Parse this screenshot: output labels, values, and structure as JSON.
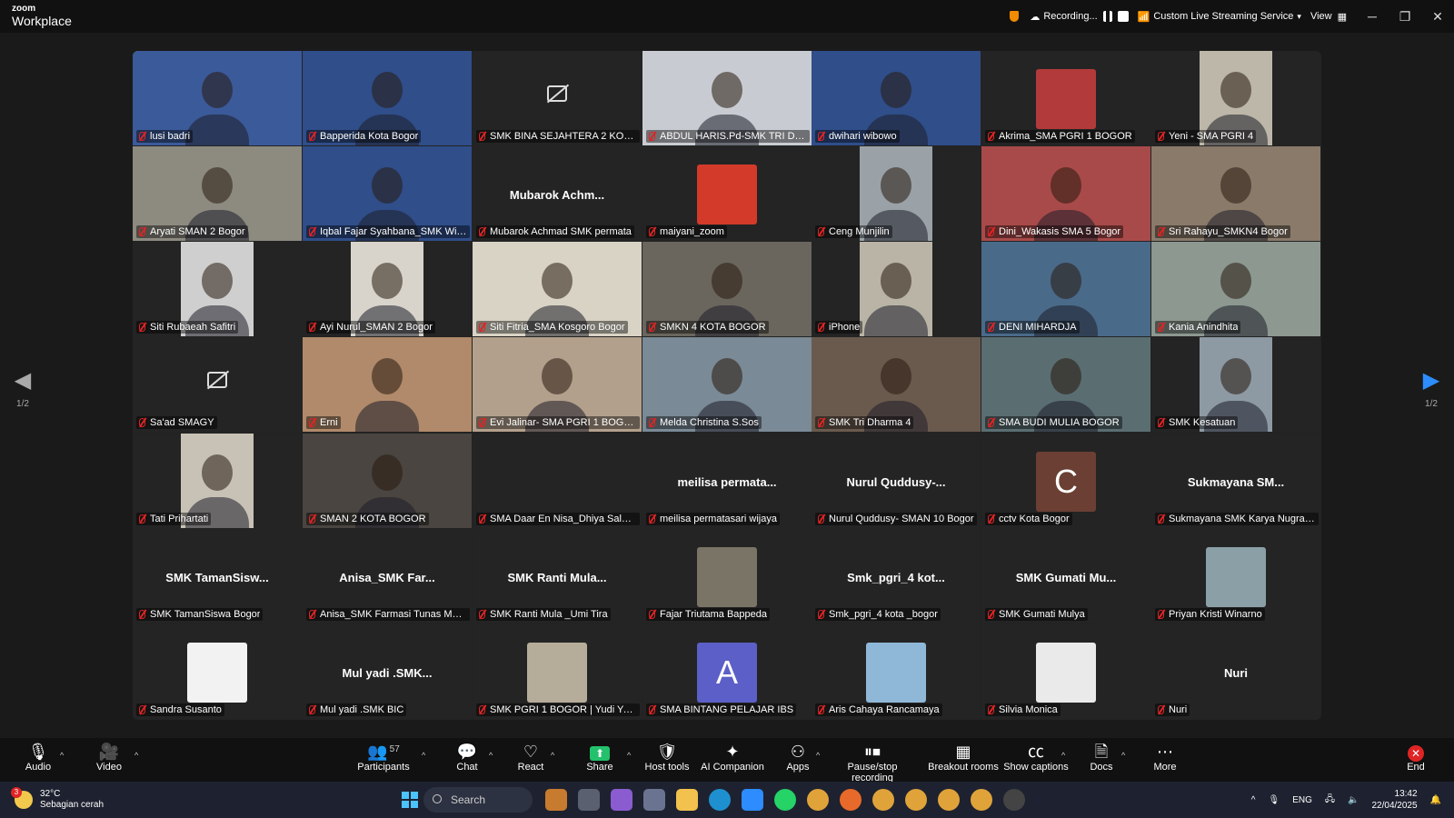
{
  "titlebar": {
    "logo_top": "zoom",
    "logo_bottom": "Workplace",
    "recording": "Recording...",
    "streaming": "Custom Live Streaming Service",
    "view": "View"
  },
  "grid": {
    "pager_label": "1/2",
    "participants": [
      {
        "label": "lusi badri",
        "color": "#3b5a9a",
        "kind": "video",
        "active": true
      },
      {
        "label": "Bapperida Kota Bogor",
        "color": "#2f4e8a",
        "kind": "video"
      },
      {
        "label": "SMK BINA SEJAHTERA 2 KOTA B...",
        "color": "#242424",
        "kind": "camoff"
      },
      {
        "label": "ABDUL HARIS.Pd-SMK TRI DHA...",
        "color": "#c8ccd2",
        "kind": "video"
      },
      {
        "label": "dwihari wibowo",
        "color": "#2f4e8a",
        "kind": "video"
      },
      {
        "label": "Akrima_SMA PGRI 1 BOGOR",
        "color": "#b33a3a",
        "kind": "avatar"
      },
      {
        "label": "Yeni - SMA PGRI 4",
        "color": "#bcb7a8",
        "kind": "narrow"
      },
      {
        "label": "Aryati SMAN 2 Bogor",
        "color": "#8d8a80",
        "kind": "video"
      },
      {
        "label": "Iqbal Fajar Syahbana_SMK Wikra...",
        "color": "#2f4e8a",
        "kind": "video"
      },
      {
        "label": "Mubarok Achmad SMK permata",
        "name": "Mubarok  Achm...",
        "color": "#242424",
        "kind": "name"
      },
      {
        "label": "maiyani_zoom",
        "color": "#d43a2a",
        "kind": "avatar"
      },
      {
        "label": "Ceng Munjilin",
        "color": "#9aa2a8",
        "kind": "narrow"
      },
      {
        "label": "Dini_Wakasis SMA 5 Bogor",
        "color": "#a94a4a",
        "kind": "video"
      },
      {
        "label": "Sri Rahayu_SMKN4 Bogor",
        "color": "#8a7a6a",
        "kind": "video"
      },
      {
        "label": "Siti Rubaeah Safitri",
        "color": "#cfcfcf",
        "kind": "narrow"
      },
      {
        "label": "Ayi Nurul_SMAN 2 Bogor",
        "color": "#d8d4cc",
        "kind": "narrow"
      },
      {
        "label": "Siti Fitria_SMA Kosgoro Bogor",
        "color": "#d9d3c5",
        "kind": "video"
      },
      {
        "label": "SMKN 4 KOTA BOGOR",
        "color": "#6a665e",
        "kind": "video"
      },
      {
        "label": "iPhone",
        "color": "#b9b4a6",
        "kind": "narrow"
      },
      {
        "label": "DENI MIHARDJA",
        "color": "#4a6a8a",
        "kind": "video"
      },
      {
        "label": "Kania Anindhita",
        "color": "#8c9890",
        "kind": "video"
      },
      {
        "label": "Sa'ad SMAGY",
        "color": "#242424",
        "kind": "camoff"
      },
      {
        "label": "Erni",
        "color": "#b08a6a",
        "kind": "video"
      },
      {
        "label": "Evi Jalinar- SMA PGRI 1 BOGOR",
        "color": "#b3a08c",
        "kind": "video"
      },
      {
        "label": "Melda Christina S.Sos",
        "color": "#7a8a96",
        "kind": "video"
      },
      {
        "label": "SMK Tri Dharma 4",
        "color": "#6a5a4e",
        "kind": "video"
      },
      {
        "label": "SMA BUDI MULIA BOGOR",
        "color": "#5a6e72",
        "kind": "video"
      },
      {
        "label": "SMK Kesatuan",
        "color": "#8d9aa4",
        "kind": "narrow"
      },
      {
        "label": "Tati Prihartati",
        "color": "#c8c2b6",
        "kind": "narrow"
      },
      {
        "label": "SMAN 2 KOTA BOGOR",
        "color": "#4a4540",
        "kind": "video"
      },
      {
        "label": "SMA Daar En Nisa_Dhiya Salma ...",
        "color": "#242424",
        "kind": "empty"
      },
      {
        "label": "meilisa permatasari wijaya",
        "name": "meilisa  permata...",
        "color": "#242424",
        "kind": "name"
      },
      {
        "label": "Nurul Quddusy- SMAN 10 Bogor",
        "name": "Nurul  Quddusy-...",
        "color": "#242424",
        "kind": "name"
      },
      {
        "label": "cctv Kota Bogor",
        "initial": "C",
        "color": "#6b3f33",
        "kind": "letter"
      },
      {
        "label": "Sukmayana SMK Karya Nugraha...",
        "name": "Sukmayana  SM...",
        "color": "#242424",
        "kind": "name"
      },
      {
        "label": "SMK TamanSiswa Bogor",
        "name": "SMK  TamanSisw...",
        "color": "#242424",
        "kind": "name"
      },
      {
        "label": "Anisa_SMK Farmasi Tunas Mandiri",
        "name": "Anisa_SMK  Far...",
        "color": "#242424",
        "kind": "name"
      },
      {
        "label": "SMK Ranti Mula _Umi Tira",
        "name": "SMK  Ranti  Mula...",
        "color": "#242424",
        "kind": "name"
      },
      {
        "label": "Fajar Triutama Bappeda",
        "color": "#7a7466",
        "kind": "avatar"
      },
      {
        "label": "Smk_pgri_4 kota _bogor",
        "name": "Smk_pgri_4  kot...",
        "color": "#242424",
        "kind": "name"
      },
      {
        "label": "SMK Gumati Mulya",
        "name": "SMK  Gumati  Mu...",
        "color": "#242424",
        "kind": "name"
      },
      {
        "label": "Priyan Kristi Winarno",
        "color": "#8aa0a6",
        "kind": "avatar"
      },
      {
        "label": "Sandra Susanto",
        "color": "#f2f2f2",
        "kind": "avatar"
      },
      {
        "label": "Mul yadi .SMK BIC",
        "name": "Mul  yadi  .SMK...",
        "color": "#242424",
        "kind": "name"
      },
      {
        "label": "SMK PGRI 1 BOGOR | Yudi Yansy...",
        "color": "#b5ad9a",
        "kind": "avatar"
      },
      {
        "label": "SMA BINTANG PELAJAR IBS",
        "initial": "A",
        "color": "#5b5fc7",
        "kind": "letter"
      },
      {
        "label": "Aris Cahaya Rancamaya",
        "color": "#8fb8d8",
        "kind": "avatar"
      },
      {
        "label": "Silvia Monica",
        "color": "#eaeaea",
        "kind": "avatar"
      },
      {
        "label": "Nuri",
        "name": "Nuri",
        "color": "#242424",
        "kind": "name"
      }
    ]
  },
  "toolbar": {
    "audio": "Audio",
    "video": "Video",
    "participants": "Participants",
    "participants_count": "57",
    "chat": "Chat",
    "react": "React",
    "share": "Share",
    "host_tools": "Host tools",
    "ai_companion": "AI Companion",
    "apps": "Apps",
    "pause_recording": "Pause/stop recording",
    "breakout": "Breakout rooms",
    "captions": "Show captions",
    "docs": "Docs",
    "more": "More",
    "end": "End"
  },
  "taskbar": {
    "temperature": "32°C",
    "weather": "Sebagian cerah",
    "weather_badge": "3",
    "search": "Search",
    "lang": "ENG",
    "time": "13:42",
    "date": "22/04/2025"
  }
}
